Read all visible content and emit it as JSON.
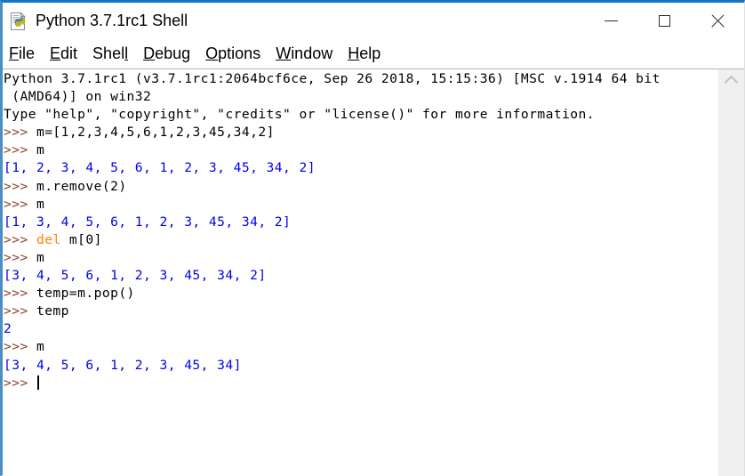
{
  "window": {
    "title": "Python 3.7.1rc1 Shell",
    "icon": "python-file-icon",
    "border_top_color": "#1076c8",
    "border_left_color": "#4a8fbf",
    "controls": [
      {
        "name": "minimize",
        "glyph": "minimize-icon",
        "label": "Minimize"
      },
      {
        "name": "maximize",
        "glyph": "maximize-icon",
        "label": "Maximize"
      },
      {
        "name": "close",
        "glyph": "close-icon",
        "label": "Close"
      }
    ]
  },
  "menubar": {
    "items": [
      {
        "name": "file",
        "pre": "",
        "accel": "F",
        "post": "ile"
      },
      {
        "name": "edit",
        "pre": "",
        "accel": "E",
        "post": "dit"
      },
      {
        "name": "shell",
        "pre": "Shel",
        "accel": "l",
        "post": ""
      },
      {
        "name": "debug",
        "pre": "",
        "accel": "D",
        "post": "ebug"
      },
      {
        "name": "options",
        "pre": "",
        "accel": "O",
        "post": "ptions"
      },
      {
        "name": "window",
        "pre": "",
        "accel": "W",
        "post": "indow"
      },
      {
        "name": "help",
        "pre": "",
        "accel": "H",
        "post": "elp"
      }
    ]
  },
  "colors": {
    "prompt": "#8b3f26",
    "stdout": "#0000ee",
    "keyword": "#ff8000",
    "normal": "#000000",
    "scrollbar_track": "#f0f0f0",
    "scrollbar_arrow": "#c0c0c0"
  },
  "scrollbar": {
    "up_arrow": "chevron-up-icon",
    "position": "top"
  },
  "console": {
    "cursor_visible": true,
    "lines": [
      {
        "spans": [
          {
            "cls": "c-normal",
            "t": "Python 3.7.1rc1 (v3.7.1rc1:2064bcf6ce, Sep 26 2018, 15:15:36) [MSC v.1914 64 bit"
          }
        ]
      },
      {
        "spans": [
          {
            "cls": "c-normal",
            "t": " (AMD64)] on win32"
          }
        ]
      },
      {
        "spans": [
          {
            "cls": "c-normal",
            "t": "Type \"help\", \"copyright\", \"credits\" or \"license()\" for more information."
          }
        ]
      },
      {
        "spans": [
          {
            "cls": "c-prompt",
            "t": ">>> "
          },
          {
            "cls": "c-normal",
            "t": "m=[1,2,3,4,5,6,1,2,3,45,34,2]"
          }
        ]
      },
      {
        "spans": [
          {
            "cls": "c-prompt",
            "t": ">>> "
          },
          {
            "cls": "c-normal",
            "t": "m"
          }
        ]
      },
      {
        "spans": [
          {
            "cls": "c-stdout",
            "t": "[1, 2, 3, 4, 5, 6, 1, 2, 3, 45, 34, 2]"
          }
        ]
      },
      {
        "spans": [
          {
            "cls": "c-prompt",
            "t": ">>> "
          },
          {
            "cls": "c-normal",
            "t": "m.remove(2)"
          }
        ]
      },
      {
        "spans": [
          {
            "cls": "c-prompt",
            "t": ">>> "
          },
          {
            "cls": "c-normal",
            "t": "m"
          }
        ]
      },
      {
        "spans": [
          {
            "cls": "c-stdout",
            "t": "[1, 3, 4, 5, 6, 1, 2, 3, 45, 34, 2]"
          }
        ]
      },
      {
        "spans": [
          {
            "cls": "c-prompt",
            "t": ">>> "
          },
          {
            "cls": "c-keyword",
            "t": "del"
          },
          {
            "cls": "c-normal",
            "t": " m[0]"
          }
        ]
      },
      {
        "spans": [
          {
            "cls": "c-prompt",
            "t": ">>> "
          },
          {
            "cls": "c-normal",
            "t": "m"
          }
        ]
      },
      {
        "spans": [
          {
            "cls": "c-stdout",
            "t": "[3, 4, 5, 6, 1, 2, 3, 45, 34, 2]"
          }
        ]
      },
      {
        "spans": [
          {
            "cls": "c-prompt",
            "t": ">>> "
          },
          {
            "cls": "c-normal",
            "t": "temp=m.pop()"
          }
        ]
      },
      {
        "spans": [
          {
            "cls": "c-prompt",
            "t": ">>> "
          },
          {
            "cls": "c-normal",
            "t": "temp"
          }
        ]
      },
      {
        "spans": [
          {
            "cls": "c-stdout",
            "t": "2"
          }
        ]
      },
      {
        "spans": [
          {
            "cls": "c-prompt",
            "t": ">>> "
          },
          {
            "cls": "c-normal",
            "t": "m"
          }
        ]
      },
      {
        "spans": [
          {
            "cls": "c-stdout",
            "t": "[3, 4, 5, 6, 1, 2, 3, 45, 34]"
          }
        ]
      },
      {
        "spans": [
          {
            "cls": "c-prompt",
            "t": ">>> "
          },
          {
            "cls": "c-normal",
            "t": "",
            "caret": true
          }
        ]
      }
    ]
  }
}
